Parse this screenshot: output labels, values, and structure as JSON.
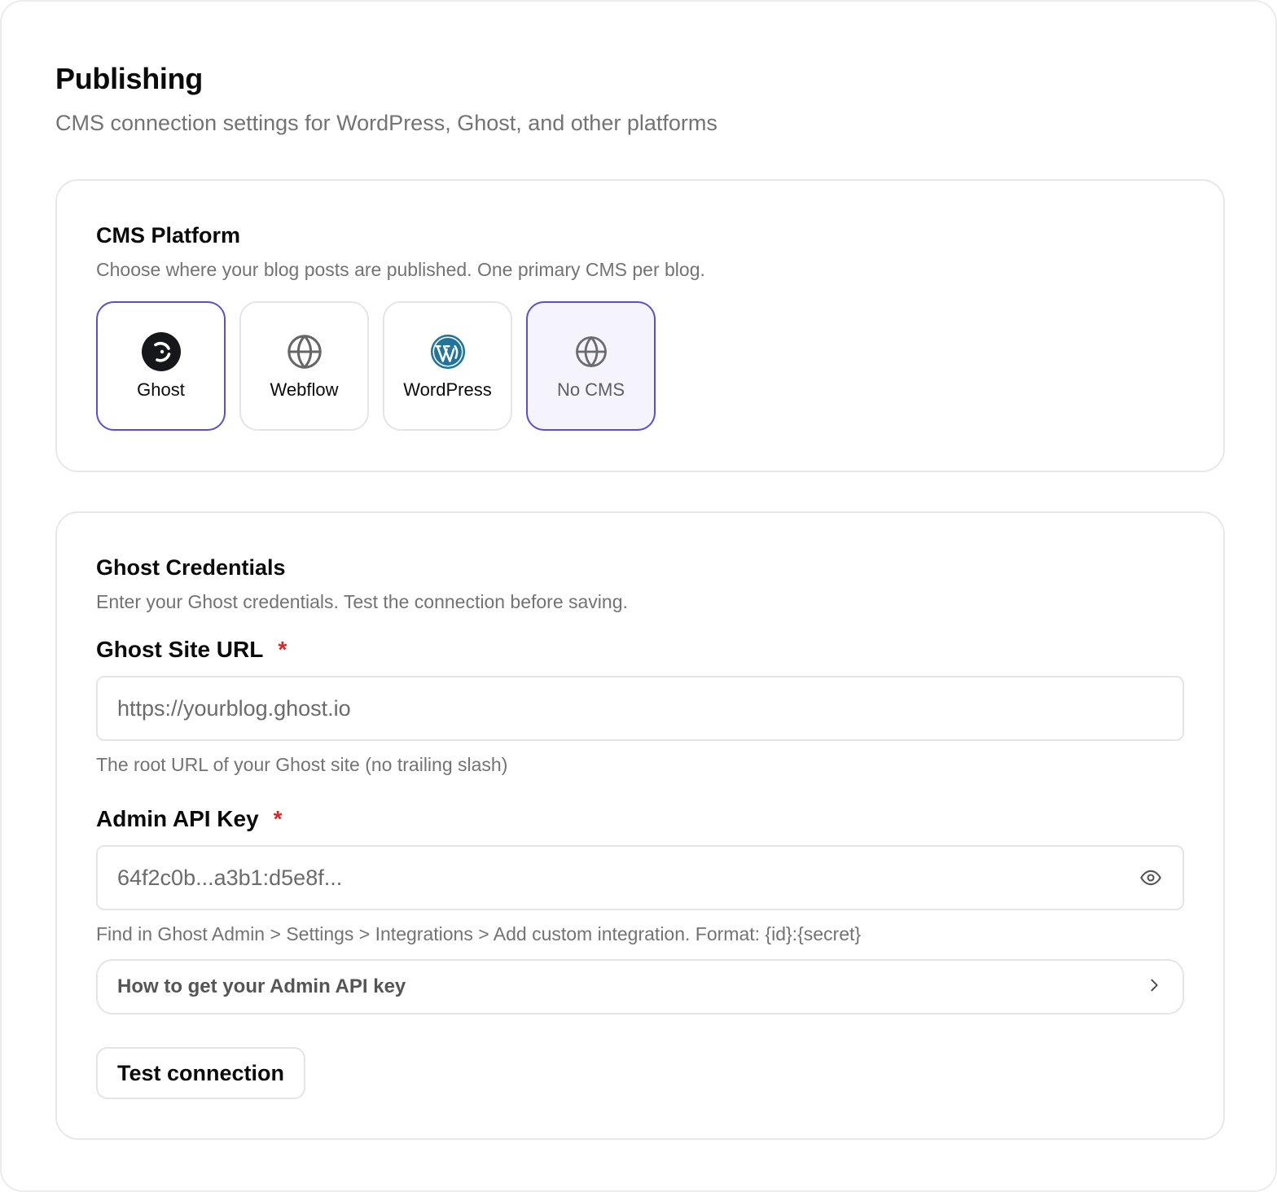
{
  "page": {
    "title": "Publishing",
    "subtitle": "CMS connection settings for WordPress, Ghost, and other platforms"
  },
  "platform": {
    "title": "CMS Platform",
    "description": "Choose where your blog posts are published. One primary CMS per blog.",
    "options": [
      {
        "label": "Ghost",
        "icon": "ghost-logo-icon",
        "state": "focused"
      },
      {
        "label": "Webflow",
        "icon": "globe-icon",
        "state": "default"
      },
      {
        "label": "WordPress",
        "icon": "wordpress-logo-icon",
        "state": "default"
      },
      {
        "label": "No CMS",
        "icon": "globe-icon",
        "state": "selected"
      }
    ]
  },
  "credentials": {
    "title": "Ghost Credentials",
    "description": "Enter your Ghost credentials. Test the connection before saving.",
    "site_url": {
      "label": "Ghost Site URL",
      "required_mark": "*",
      "placeholder": "https://yourblog.ghost.io",
      "hint": "The root URL of your Ghost site (no trailing slash)"
    },
    "api_key": {
      "label": "Admin API Key",
      "required_mark": "*",
      "placeholder": "64f2c0b...a3b1:d5e8f...",
      "hint": "Find in Ghost Admin > Settings > Integrations > Add custom integration. Format: {id}:{secret}",
      "toggle_icon": "eye-icon"
    },
    "help_accordion": {
      "label": "How to get your Admin API key",
      "icon": "chevron-right-icon"
    },
    "test_button": "Test connection"
  },
  "colors": {
    "accent": "#5b4fcf",
    "selected_bg": "#f5f4fd",
    "required": "#dc2626",
    "wordpress": "#21759b",
    "muted_text": "#737373"
  }
}
